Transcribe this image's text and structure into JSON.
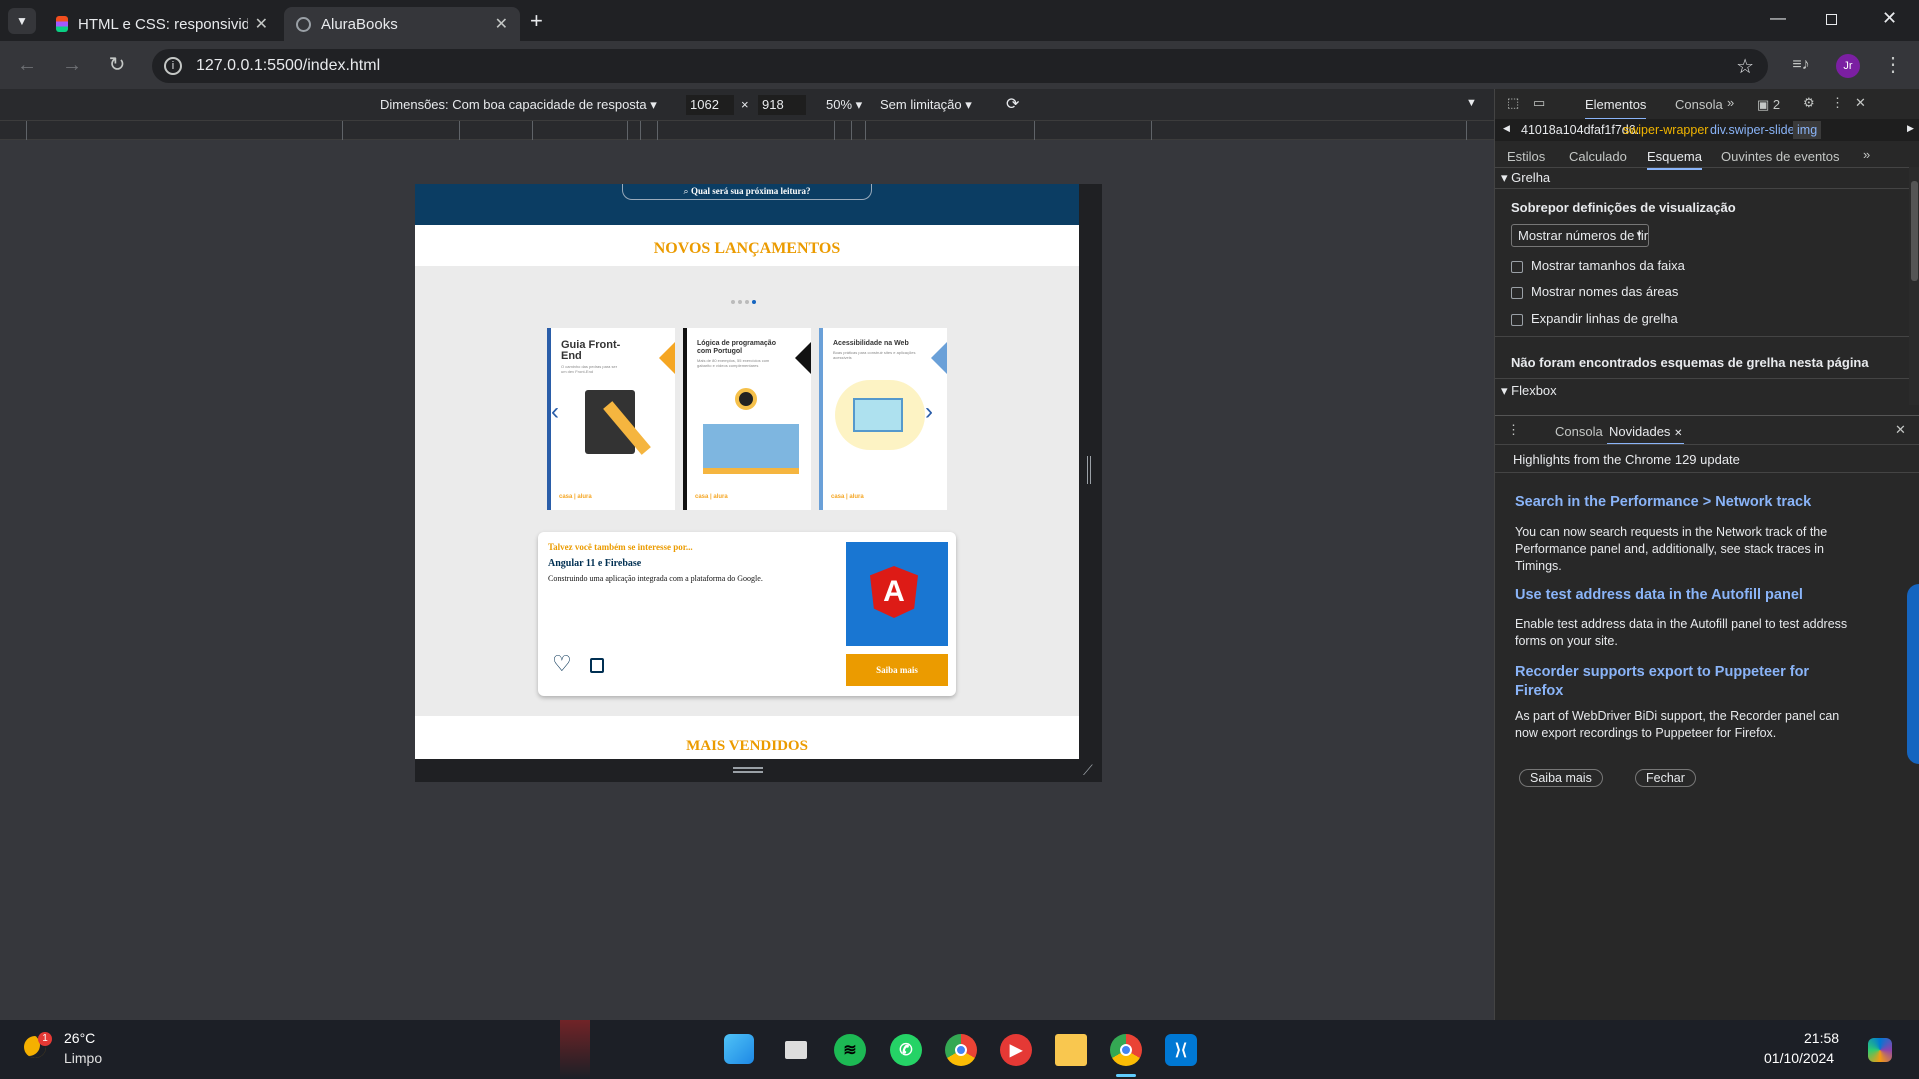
{
  "browser": {
    "tabs": [
      {
        "title": "HTML e CSS: responsividade co",
        "active": false
      },
      {
        "title": "AluraBooks",
        "active": true
      }
    ],
    "new_tab": "+",
    "url": "127.0.0.1:5500/index.html",
    "profile": "Jr"
  },
  "device_toolbar": {
    "dimensions": "Dimensões: Com boa capacidade de resposta",
    "width": "1062",
    "x": "×",
    "height": "918",
    "zoom": "50%",
    "throttle": "Sem limitação"
  },
  "page": {
    "search_placeholder": "Qual será sua próxima leitura?",
    "section1_title": "NOVOS LANÇAMENTOS",
    "books": [
      {
        "title": "Guia Front-End",
        "subtitle": "O caminho das pedras para ser um dev Front-End",
        "accent": "#f5a623"
      },
      {
        "title": "Lógica de programação com Portugol",
        "subtitle": "Mais de 80 exemplos, 55 exercícios com gabarito e vídeos complementares",
        "accent": "#000000"
      },
      {
        "title": "Acessibilidade na Web",
        "subtitle": "Boas práticas para construir sites e aplicações acessíveis",
        "accent": "#6aa0d8"
      }
    ],
    "suggest_kicker": "Talvez você também se interesse por...",
    "suggest_title": "Angular 11 e Firebase",
    "suggest_desc": "Construindo uma aplicação integrada com a plataforma do Google.",
    "suggest_button": "Saiba mais",
    "section2_title": "MAIS VENDIDOS",
    "colors": {
      "accent": "#eb9b00",
      "title": "#eb9b00",
      "navy": "#002f52"
    }
  },
  "devtools": {
    "tabs": [
      "Elementos",
      "Consola"
    ],
    "issues": "2",
    "breadcrumb": [
      "41018a104dfaf1f7d6.",
      "swiper-wrapper",
      "div.swiper-slide",
      "img"
    ],
    "subtabs": [
      "Estilos",
      "Calculado",
      "Esquema",
      "Ouvintes de eventos"
    ],
    "grid_section": "Grelha",
    "overlay_title": "Sobrepor definições de visualização",
    "select_value": "Mostrar números de lir",
    "checkboxes": [
      "Mostrar tamanhos da faixa",
      "Mostrar nomes das áreas",
      "Expandir linhas de grelha"
    ],
    "no_grid": "Não foram encontrados esquemas de grelha nesta página",
    "flex_section": "Flexbox",
    "drawer_tabs": [
      "Consola",
      "Novidades"
    ],
    "drawer_header": "Highlights from the Chrome 129 update",
    "news": [
      {
        "title": "Search in the Performance > Network track",
        "body": "You can now search requests in the Network track of the Performance panel and, additionally, see stack traces in Timings."
      },
      {
        "title": "Use test address data in the Autofill panel",
        "body": "Enable test address data in the Autofill panel to test address forms on your site."
      },
      {
        "title": "Recorder supports export to Puppeteer for Firefox",
        "body": "As part of WebDriver BiDi support, the Recorder panel can now export recordings to Puppeteer for Firefox."
      }
    ],
    "learn_more": "Saiba mais",
    "close": "Fechar"
  },
  "taskbar": {
    "weather_temp": "26°C",
    "weather_desc": "Limpo",
    "weather_badge": "1",
    "time": "21:58",
    "date": "01/10/2024"
  }
}
